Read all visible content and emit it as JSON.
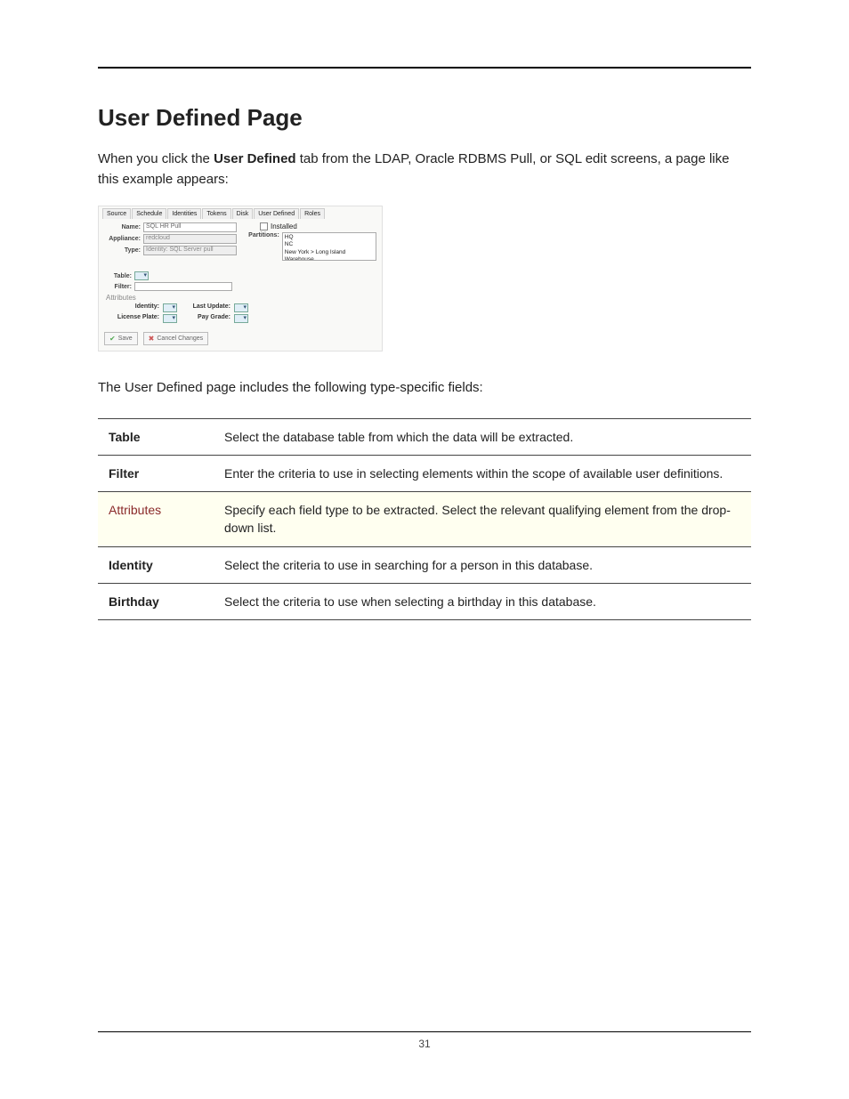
{
  "heading": "User Defined Page",
  "intro_pre": "When you click the ",
  "intro_bold": "User Defined",
  "intro_post": " tab from the LDAP, Oracle RDBMS Pull, or SQL edit screens, a page like this example appears:",
  "after": "The User Defined page includes the following type-specific fields:",
  "page_number": "31",
  "ui": {
    "tabs": [
      "Source",
      "Schedule",
      "Identities",
      "Tokens",
      "Disk",
      "User Defined",
      "Roles"
    ],
    "name_label": "Name:",
    "name_value": "SQL HR Pull",
    "appliance_label": "Appliance:",
    "appliance_value": "redcloud",
    "type_label": "Type:",
    "type_value": "Identity: SQL Server pull",
    "installed_label": "Installed",
    "partitions_label": "Partitions:",
    "partitions": [
      "HQ",
      "NC",
      "New York > Long Island Warehouse"
    ],
    "table_label": "Table:",
    "filter_label": "Filter:",
    "attributes_label": "Attributes",
    "attr_identity": "Identity:",
    "attr_lastupdate": "Last Update:",
    "attr_license": "License Plate:",
    "attr_paygrade": "Pay Grade:",
    "save": "Save",
    "cancel": "Cancel Changes"
  },
  "fields": [
    {
      "name": "Table",
      "desc": "Select the database table from which the data will be extracted."
    },
    {
      "name": "Filter",
      "desc": "Enter the criteria to use in selecting elements within the scope of available user definitions."
    },
    {
      "name": "Attributes",
      "desc": "Specify each field type to be extracted. Select the relevant qualifying element from the drop-down list.",
      "hl": true
    },
    {
      "name": "Identity",
      "desc": "Select the criteria to use in searching for a person in this database."
    },
    {
      "name": "Birthday",
      "desc": "Select the criteria to use when selecting a birthday in this database."
    }
  ]
}
